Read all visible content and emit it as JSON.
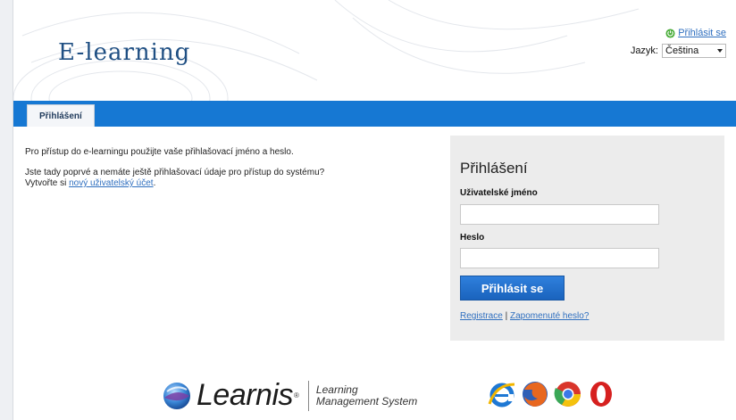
{
  "header": {
    "title": "E-learning",
    "logout_label": "Přihlásit se",
    "language_label": "Jazyk:",
    "language_value": "Čeština"
  },
  "nav": {
    "active_tab": "Přihlášení"
  },
  "intro": {
    "line1": "Pro přístup do e-learningu použijte vaše přihlašovací jméno a heslo.",
    "line2": "Jste tady poprvé a nemáte ještě přihlašovací údaje pro přístup do systému?",
    "line3_prefix": "Vytvořte si",
    "line3_link": "nový uživatelský účet",
    "line3_suffix": "."
  },
  "login": {
    "title": "Přihlášení",
    "username_label": "Uživatelské jméno",
    "username_value": "",
    "password_label": "Heslo",
    "password_value": "",
    "submit_label": "Přihlásit se",
    "register_link": "Registrace",
    "separator": "|",
    "forgot_link": "Zapomenuté heslo?"
  },
  "footer": {
    "brand": "Learnis",
    "brand_reg": "®",
    "tagline_line1": "Learning",
    "tagline_line2": "Management System",
    "browser_icons": [
      "internet-explorer-icon",
      "firefox-icon",
      "chrome-icon",
      "opera-icon"
    ]
  },
  "colors": {
    "nav_blue": "#1678d3",
    "title_blue": "#1f4f83",
    "link_blue": "#2f6fbf",
    "panel_gray": "#ececec"
  }
}
